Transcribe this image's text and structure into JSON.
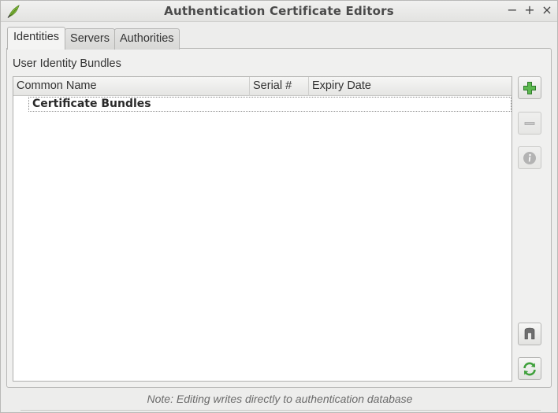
{
  "window": {
    "title": "Authentication Certificate Editors",
    "minimize_glyph": "−",
    "maximize_glyph": "+",
    "close_glyph": "×",
    "app_icon": "qgis-leaf-icon"
  },
  "tabs": [
    {
      "label": "Identities",
      "active": true
    },
    {
      "label": "Servers",
      "active": false
    },
    {
      "label": "Authorities",
      "active": false
    }
  ],
  "panel": {
    "group_label": "User Identity Bundles",
    "columns": [
      "Common Name",
      "Serial #",
      "Expiry Date"
    ],
    "rows": [
      {
        "label": "Certificate Bundles"
      }
    ]
  },
  "side_buttons": [
    {
      "name": "add-identity",
      "icon": "plus-icon",
      "enabled": true
    },
    {
      "name": "remove-identity",
      "icon": "minus-icon",
      "enabled": false
    },
    {
      "name": "info",
      "icon": "info-icon",
      "enabled": false
    },
    {
      "name": "utilities",
      "icon": "utilities-icon",
      "enabled": true
    },
    {
      "name": "refresh",
      "icon": "refresh-icon",
      "enabled": true
    }
  ],
  "note": "Note: Editing writes directly to authentication database",
  "colors": {
    "accent_green": "#3fa03b",
    "disabled_gray": "#a7a7a7"
  }
}
